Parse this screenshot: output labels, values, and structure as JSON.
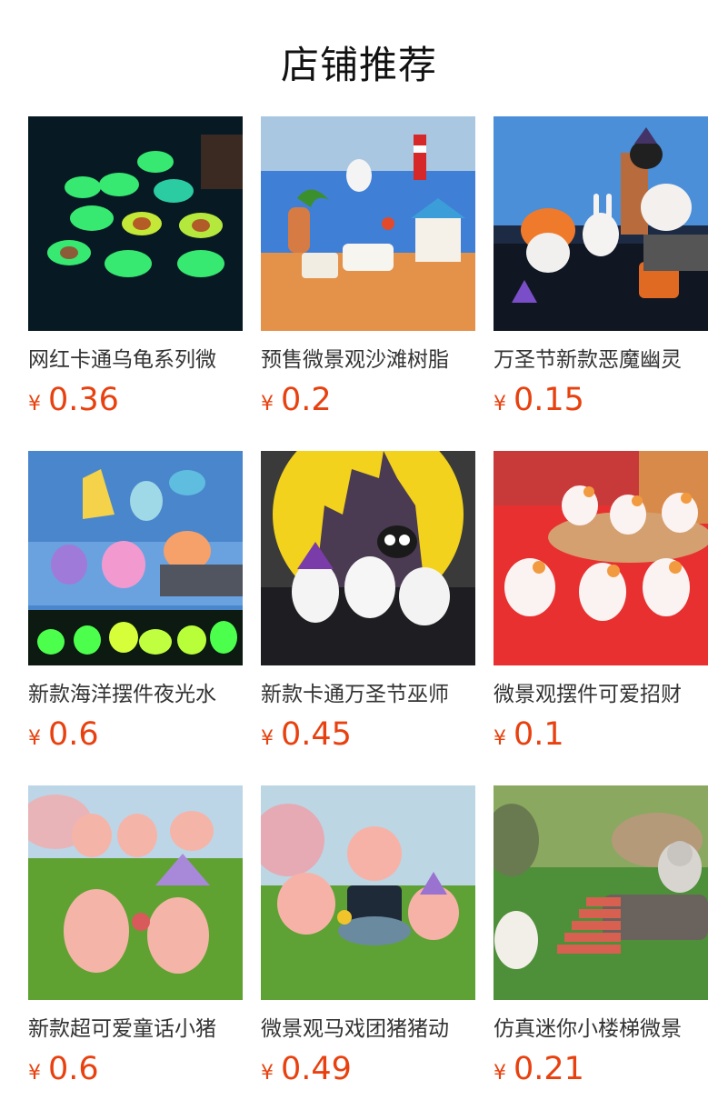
{
  "page": {
    "title": "店铺推荐"
  },
  "currency": "¥",
  "products": [
    {
      "name": "网红卡通乌龟系列微",
      "price": "0.36",
      "theme": "glow-turtles"
    },
    {
      "name": "预售微景观沙滩树脂",
      "price": "0.2",
      "theme": "beach-scene"
    },
    {
      "name": "万圣节新款恶魔幽灵",
      "price": "0.15",
      "theme": "halloween-bunnies"
    },
    {
      "name": "新款海洋摆件夜光水",
      "price": "0.6",
      "theme": "ocean-glow"
    },
    {
      "name": "新款卡通万圣节巫师",
      "price": "0.45",
      "theme": "halloween-ghosts"
    },
    {
      "name": "微景观摆件可爱招财",
      "price": "0.1",
      "theme": "lucky-cats"
    },
    {
      "name": "新款超可爱童话小猪",
      "price": "0.6",
      "theme": "fairy-pigs"
    },
    {
      "name": "微景观马戏团猪猪动",
      "price": "0.49",
      "theme": "circus-pigs"
    },
    {
      "name": "仿真迷你小楼梯微景",
      "price": "0.21",
      "theme": "mini-stairs"
    }
  ],
  "colors": {
    "price": "#e8410f",
    "title": "#111111",
    "name": "#333333"
  }
}
